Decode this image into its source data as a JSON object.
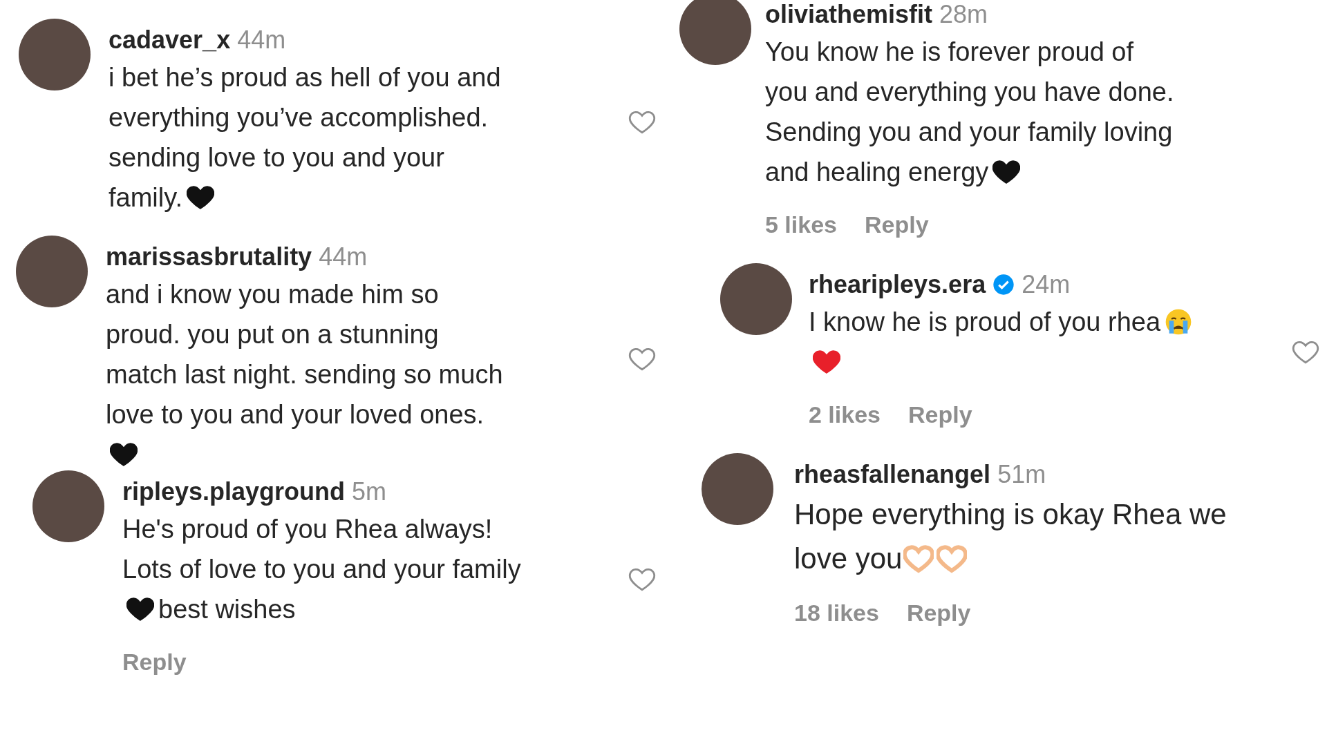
{
  "columns": [
    {
      "comments": [
        {
          "username": "cadaver_x",
          "time": "44m",
          "verified": false,
          "liked": false,
          "lines": [
            [
              {
                "kind": "text",
                "text": "i bet he’s proud as hell of you and"
              }
            ],
            [
              {
                "kind": "text",
                "text": "everything you’ve accomplished."
              }
            ],
            [
              {
                "kind": "text",
                "text": "sending love to you and your"
              }
            ],
            [
              {
                "kind": "text",
                "text": "family."
              },
              {
                "kind": "black-heart"
              }
            ]
          ]
        },
        {
          "username": "marissasbrutality",
          "time": "44m",
          "verified": false,
          "liked": false,
          "lines": [
            [
              {
                "kind": "text",
                "text": "and i know you made him so"
              }
            ],
            [
              {
                "kind": "text",
                "text": "proud. you put on a stunning"
              }
            ],
            [
              {
                "kind": "text",
                "text": "match last night. sending so much"
              }
            ],
            [
              {
                "kind": "text",
                "text": "love to you and your loved ones."
              }
            ],
            [
              {
                "kind": "black-heart"
              }
            ]
          ]
        },
        {
          "username": "ripleys.playground",
          "time": "5m",
          "verified": false,
          "liked": false,
          "lines": [
            [
              {
                "kind": "text",
                "text": "He's proud of you Rhea always!"
              }
            ],
            [
              {
                "kind": "text",
                "text": "Lots of love to you and your family"
              }
            ],
            [
              {
                "kind": "black-heart"
              },
              {
                "kind": "text",
                "text": "best wishes"
              }
            ]
          ],
          "reply": "Reply"
        }
      ]
    },
    {
      "comments": [
        {
          "username": "oliviathemisfit",
          "time": "28m",
          "verified": false,
          "lines": [
            [
              {
                "kind": "text",
                "text": "You know he is forever proud of"
              }
            ],
            [
              {
                "kind": "text",
                "text": "you and everything you have done."
              }
            ],
            [
              {
                "kind": "text",
                "text": "Sending you and your family loving"
              }
            ],
            [
              {
                "kind": "text",
                "text": "and healing energy"
              },
              {
                "kind": "black-heart"
              }
            ]
          ],
          "likes": "5 likes",
          "reply": "Reply"
        },
        {
          "username": "rhearipleys.era",
          "time": "24m",
          "verified": true,
          "liked": false,
          "lines": [
            [
              {
                "kind": "text",
                "text": "I know he is proud of you rhea"
              },
              {
                "kind": "crying-face"
              }
            ],
            [
              {
                "kind": "red-heart"
              }
            ]
          ],
          "likes": "2 likes",
          "reply": "Reply"
        },
        {
          "username": "rheasfallenangel",
          "time": "51m",
          "verified": false,
          "lines": [
            [
              {
                "kind": "text",
                "text": "Hope everything is okay Rhea we"
              }
            ],
            [
              {
                "kind": "text",
                "text": "love you"
              },
              {
                "kind": "heart-hands"
              },
              {
                "kind": "heart-hands"
              }
            ]
          ],
          "likes": "18 likes",
          "reply": "Reply"
        }
      ]
    }
  ]
}
